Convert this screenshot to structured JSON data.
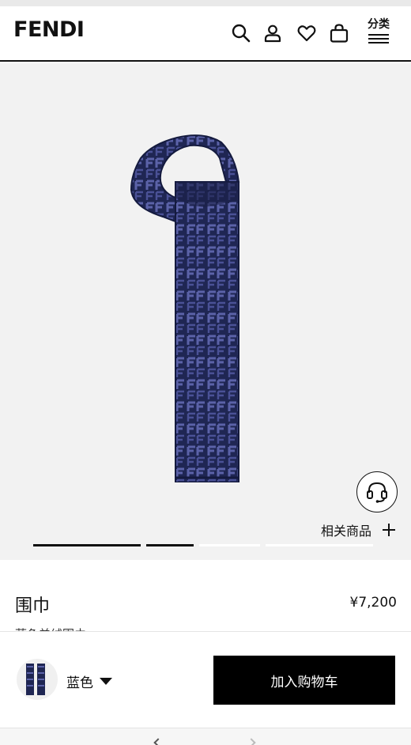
{
  "header": {
    "logo": "FENDI",
    "menu_label": "分类",
    "icons": [
      "search-icon",
      "user-icon",
      "heart-icon",
      "bag-icon",
      "menu-icon"
    ]
  },
  "gallery": {
    "related_label": "相关商品",
    "image_count": 4,
    "active_image": 1,
    "colors": {
      "scarf_base": "#1f2653",
      "scarf_pattern": "#5b62a8",
      "background": "#f2f2f2"
    }
  },
  "product": {
    "title": "围巾",
    "price": "¥7,200",
    "subtitle": "蓝色羊绒围巾"
  },
  "purchase": {
    "color_option": "蓝色",
    "add_to_cart_label": "加入购物车",
    "button_color": "#000000"
  }
}
